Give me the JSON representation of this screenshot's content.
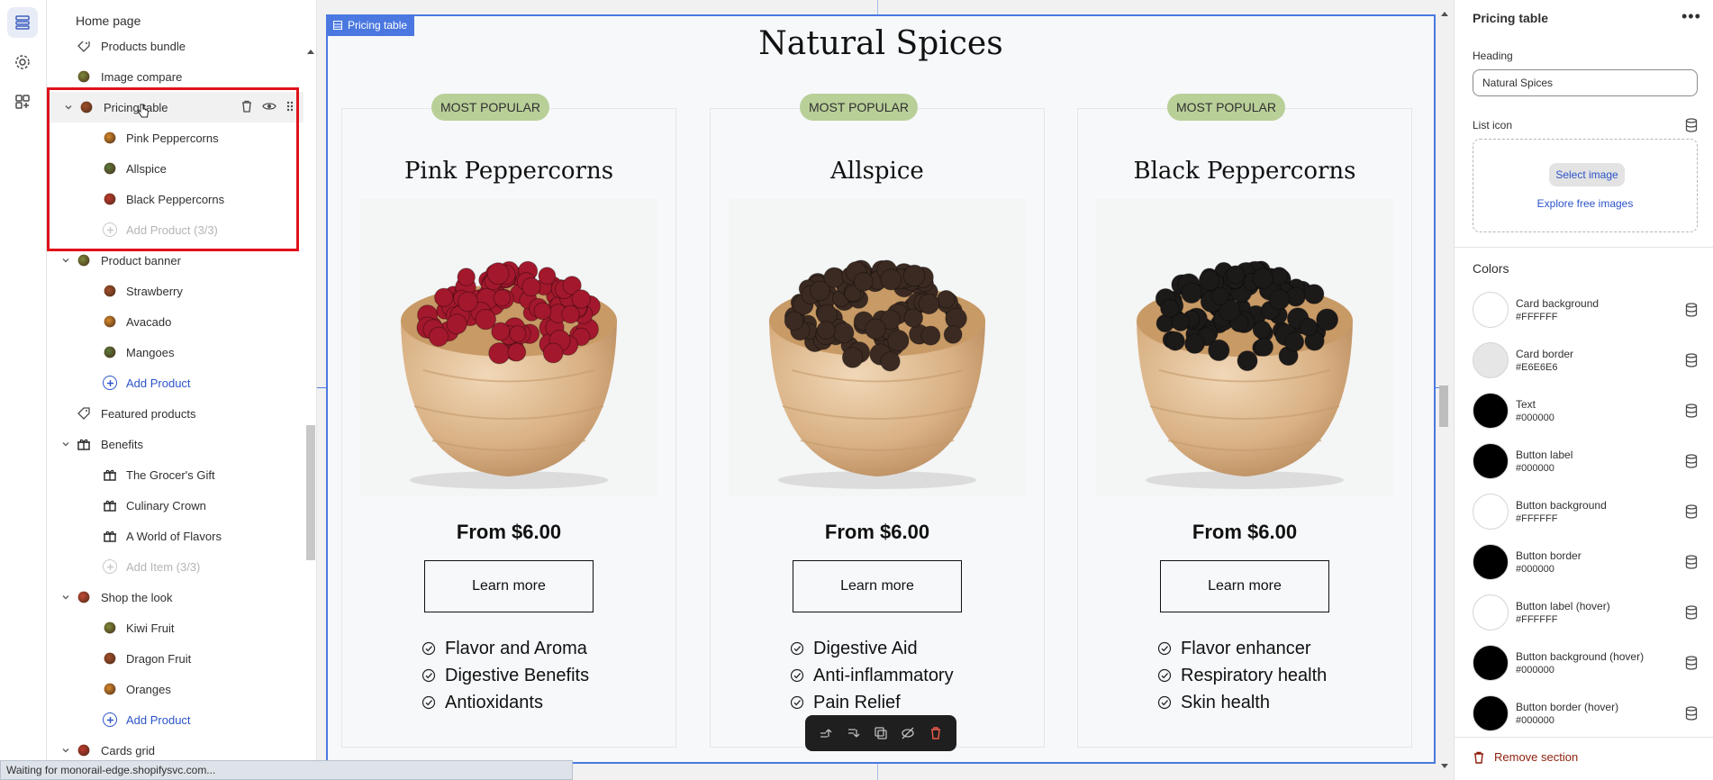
{
  "sidebar": {
    "title": "Home page",
    "items": [
      {
        "label": "Products bundle",
        "level": 1,
        "icon": "tag-icon"
      },
      {
        "label": "Image compare",
        "level": 1,
        "icon": "image-icon"
      },
      {
        "label": "Pricing table",
        "level": 1,
        "icon": "pepper-icon",
        "expanded": true,
        "selected": true
      },
      {
        "label": "Pink Peppercorns",
        "level": 2,
        "icon": "pepper-icon"
      },
      {
        "label": "Allspice",
        "level": 2,
        "icon": "pepper-icon"
      },
      {
        "label": "Black Peppercorns",
        "level": 2,
        "icon": "pepper-icon"
      },
      {
        "label": "Add Product (3/3)",
        "level": 2,
        "icon": "add-circle-icon",
        "disabled": true
      },
      {
        "label": "Product banner",
        "level": 1,
        "icon": "fruit-icon",
        "expanded": true
      },
      {
        "label": "Strawberry",
        "level": 2,
        "icon": "strawberry-icon"
      },
      {
        "label": "Avacado",
        "level": 2,
        "icon": "avocado-icon"
      },
      {
        "label": "Mangoes",
        "level": 2,
        "icon": "mango-icon"
      },
      {
        "label": "Add Product",
        "level": 2,
        "icon": "add-circle-icon",
        "link": true
      },
      {
        "label": "Featured products",
        "level": 1,
        "icon": "tag-icon"
      },
      {
        "label": "Benefits",
        "level": 1,
        "icon": "gift-icon",
        "expanded": true
      },
      {
        "label": "The Grocer's Gift",
        "level": 2,
        "icon": "gift-icon"
      },
      {
        "label": "Culinary Crown",
        "level": 2,
        "icon": "crown-icon"
      },
      {
        "label": "A World of Flavors",
        "level": 2,
        "icon": "globe-icon"
      },
      {
        "label": "Add Item (3/3)",
        "level": 2,
        "icon": "add-circle-icon",
        "disabled": true
      },
      {
        "label": "Shop the look",
        "level": 1,
        "icon": "fruit-basket-icon",
        "expanded": true
      },
      {
        "label": "Kiwi Fruit",
        "level": 2,
        "icon": "kiwi-icon"
      },
      {
        "label": "Dragon Fruit",
        "level": 2,
        "icon": "dragon-fruit-icon"
      },
      {
        "label": "Oranges",
        "level": 2,
        "icon": "orange-icon"
      },
      {
        "label": "Add Product",
        "level": 2,
        "icon": "add-circle-icon",
        "link": true
      },
      {
        "label": "Cards grid",
        "level": 1,
        "icon": "fruit-basket-icon",
        "expanded": true
      }
    ]
  },
  "status_bar": "Waiting for monorail-edge.shopifysvc.com...",
  "preview": {
    "section_tag": "Pricing table",
    "heading": "Natural Spices",
    "cards": [
      {
        "badge": "MOST POPULAR",
        "title": "Pink Peppercorns",
        "price": "From $6.00",
        "button": "Learn more",
        "features": [
          "Flavor and Aroma",
          "Digestive Benefits",
          "Antioxidants"
        ],
        "pepper_color": "#a3182c"
      },
      {
        "badge": "MOST POPULAR",
        "title": "Allspice",
        "price": "From $6.00",
        "button": "Learn more",
        "features": [
          "Digestive Aid",
          "Anti-inflammatory",
          "Pain Relief"
        ],
        "pepper_color": "#3b2a22"
      },
      {
        "badge": "MOST POPULAR",
        "title": "Black Peppercorns",
        "price": "From $6.00",
        "button": "Learn more",
        "features": [
          "Flavor enhancer",
          "Respiratory health",
          "Skin health"
        ],
        "pepper_color": "#1c1a19"
      }
    ]
  },
  "panel": {
    "title": "Pricing table",
    "heading_label": "Heading",
    "heading_value": "Natural Spices",
    "list_icon_label": "List icon",
    "select_image": "Select image",
    "explore_images": "Explore free images",
    "colors_heading": "Colors",
    "colors": [
      {
        "name": "Card background",
        "hex": "#FFFFFF"
      },
      {
        "name": "Card border",
        "hex": "#E6E6E6"
      },
      {
        "name": "Text",
        "hex": "#000000"
      },
      {
        "name": "Button label",
        "hex": "#000000"
      },
      {
        "name": "Button background",
        "hex": "#FFFFFF"
      },
      {
        "name": "Button border",
        "hex": "#000000"
      },
      {
        "name": "Button label (hover)",
        "hex": "#FFFFFF"
      },
      {
        "name": "Button background (hover)",
        "hex": "#000000"
      },
      {
        "name": "Button border (hover)",
        "hex": "#000000"
      }
    ],
    "remove_section": "Remove section"
  },
  "theme": {
    "accent": "#4a78e0",
    "highlight": "#e0121b",
    "badge": "#b9cf98",
    "link": "#2c54c9",
    "danger": "#8e1f0b"
  }
}
